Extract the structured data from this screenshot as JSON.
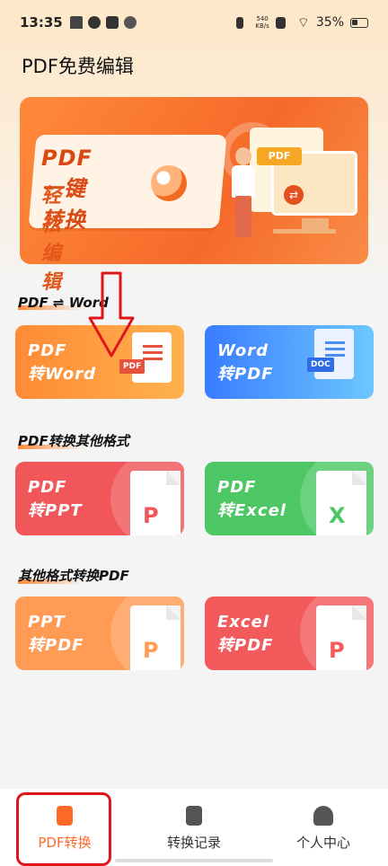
{
  "status_bar": {
    "time": "13:35",
    "net_speed_value": "540",
    "net_speed_unit": "KB/s",
    "battery": "35%"
  },
  "app": {
    "title": "PDF免费编辑"
  },
  "banner": {
    "line1": "PDF一键转换",
    "line2": "轻松编辑",
    "doc_tag": "PDF"
  },
  "sections": [
    {
      "title": "PDF ⇌ Word",
      "cards": [
        {
          "label": "PDF\n转Word",
          "icon": "pdf-doc-icon",
          "tag": "PDF",
          "color": "#ff8f3a"
        },
        {
          "label": "Word\n转PDF",
          "icon": "word-doc-icon",
          "tag": "DOC",
          "color": "#3a8cff"
        }
      ]
    },
    {
      "title": "PDF转换其他格式",
      "cards": [
        {
          "label": "PDF\n转PPT",
          "icon": "ppt-file-icon",
          "letter": "P",
          "color": "#f0565a"
        },
        {
          "label": "PDF\n转Excel",
          "icon": "excel-file-icon",
          "letter": "X",
          "color": "#4cc764"
        }
      ]
    },
    {
      "title": "其他格式转换PDF",
      "cards": [
        {
          "label": "PPT\n转PDF",
          "icon": "ppt-file-icon",
          "letter": "P",
          "color": "#ff9b55"
        },
        {
          "label": "Excel\n转PDF",
          "icon": "pdf-file-icon",
          "letter": "P",
          "color": "#f25a5c"
        }
      ]
    }
  ],
  "bottom_nav": {
    "items": [
      {
        "label": "PDF转换",
        "icon": "convert-icon",
        "active": true
      },
      {
        "label": "转换记录",
        "icon": "record-icon",
        "active": false
      },
      {
        "label": "个人中心",
        "icon": "profile-icon",
        "active": false
      }
    ]
  },
  "colors": {
    "accent": "#ff6a2a",
    "annotation": "#e0161a"
  }
}
